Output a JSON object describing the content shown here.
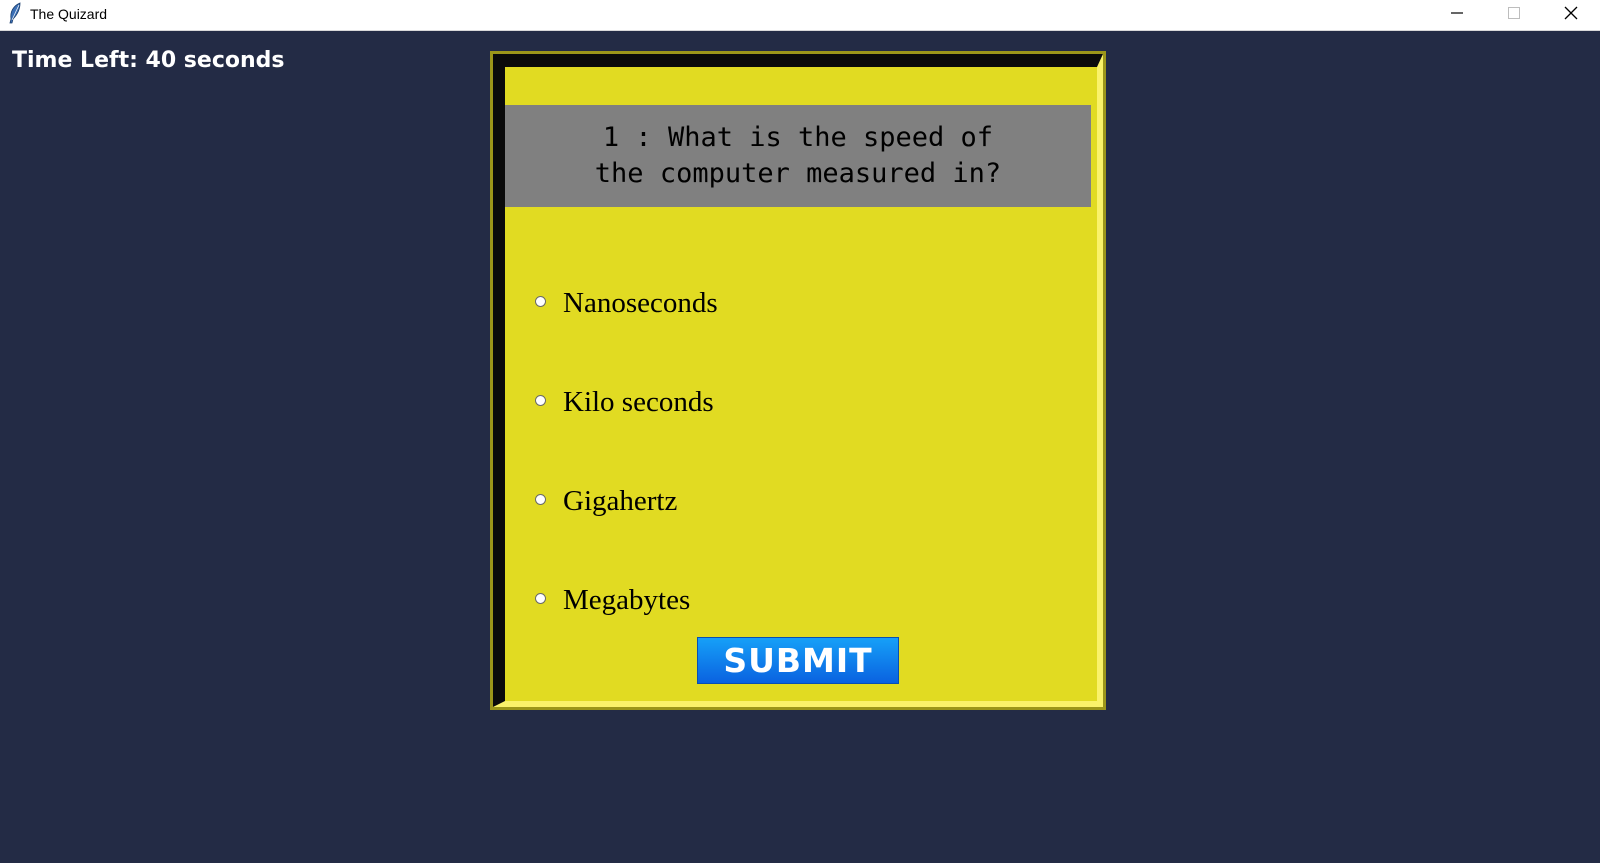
{
  "window": {
    "title": "The Quizard",
    "icon": "feather-icon",
    "controls": [
      "minimize-icon",
      "maximize-icon",
      "close-icon"
    ]
  },
  "timer": {
    "text": "Time Left: 40 seconds"
  },
  "quiz": {
    "question_line1": "1 : What is the speed of",
    "question_line2": "the computer measured in?",
    "options": [
      {
        "label": "Nanoseconds"
      },
      {
        "label": "Kilo seconds"
      },
      {
        "label": "Gigahertz"
      },
      {
        "label": "Megabytes"
      }
    ],
    "submit_label": "SUBMIT"
  },
  "colors": {
    "background": "#232b45",
    "panel": "#e1db22",
    "question_bg": "#808080",
    "submit": "#0a7ff0"
  }
}
